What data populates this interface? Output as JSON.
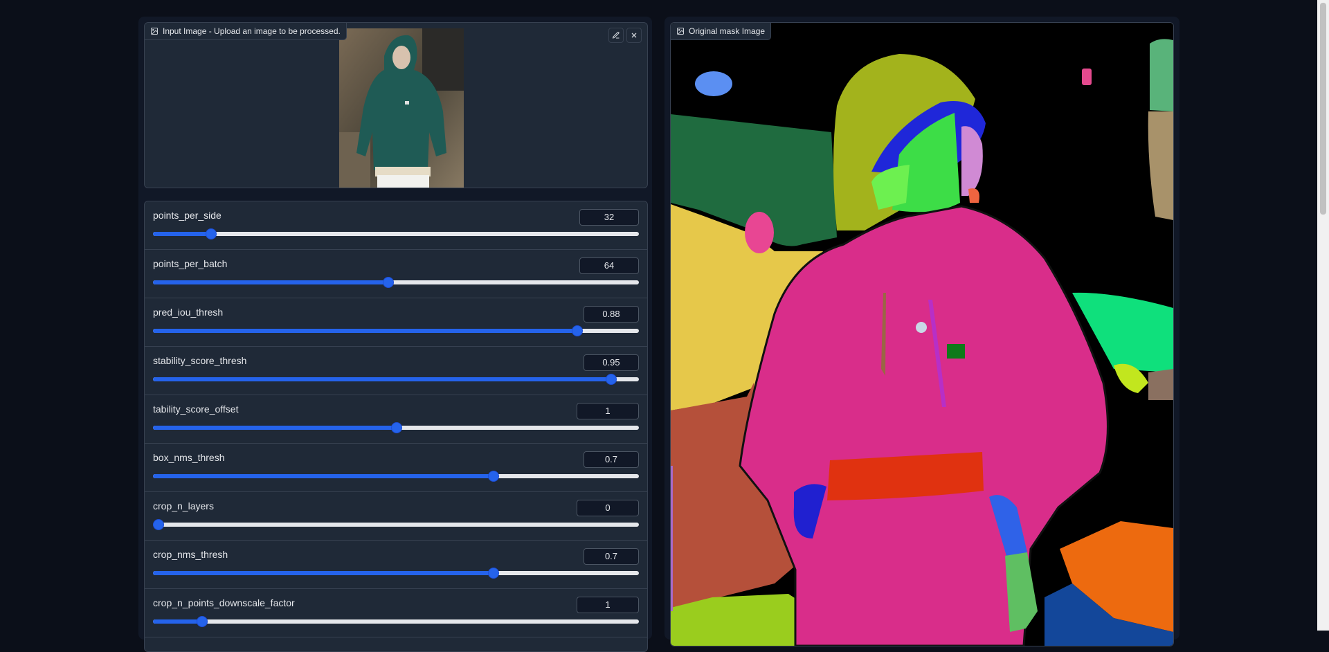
{
  "input_panel": {
    "label": "Input Image - Upload an image to be processed.",
    "icons": [
      "image-icon",
      "edit-icon",
      "close-icon"
    ]
  },
  "output_panel": {
    "label": "Original mask Image",
    "icons": [
      "image-icon"
    ]
  },
  "colors": {
    "accent": "#2563eb",
    "background": "#0b0f19",
    "panel": "#1f2937",
    "border": "#374151"
  },
  "sliders": [
    {
      "label": "points_per_side",
      "value": "32",
      "fraction": 0.118
    },
    {
      "label": "points_per_batch",
      "value": "64",
      "fraction": 0.483
    },
    {
      "label": "pred_iou_thresh",
      "value": "0.88",
      "fraction": 0.872
    },
    {
      "label": "stability_score_thresh",
      "value": "0.95",
      "fraction": 0.941
    },
    {
      "label": "tability_score_offset",
      "value": "1",
      "fraction": 0.5
    },
    {
      "label": "box_nms_thresh",
      "value": "0.7",
      "fraction": 0.7
    },
    {
      "label": "crop_n_layers",
      "value": "0",
      "fraction": 0.0
    },
    {
      "label": "crop_nms_thresh",
      "value": "0.7",
      "fraction": 0.7
    },
    {
      "label": "crop_n_points_downscale_factor",
      "value": "1",
      "fraction": 0.1
    }
  ]
}
